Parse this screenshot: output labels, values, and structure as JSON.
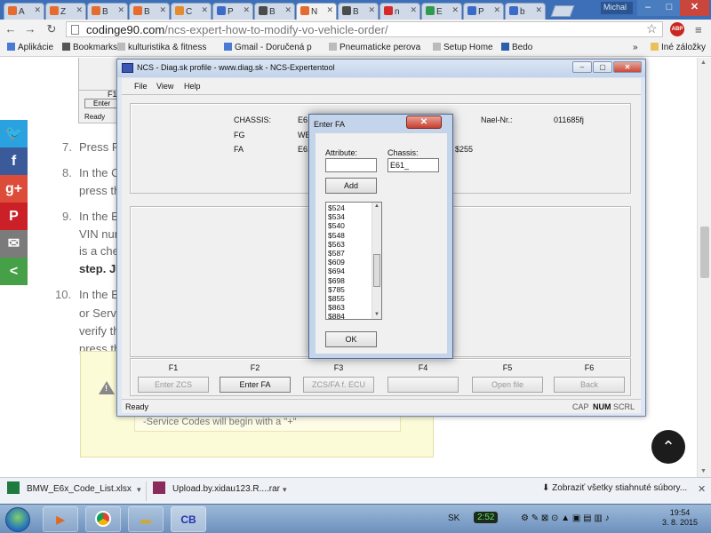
{
  "browser": {
    "tabs": [
      {
        "label": "A",
        "color": "#e56b2f"
      },
      {
        "label": "Z",
        "color": "#e56b2f"
      },
      {
        "label": "B",
        "color": "#e56b2f"
      },
      {
        "label": "B",
        "color": "#e56b2f"
      },
      {
        "label": "C",
        "color": "#e58a2f"
      },
      {
        "label": "P",
        "color": "#3b6bc9"
      },
      {
        "label": "B",
        "color": "#4b4b4b"
      },
      {
        "label": "N",
        "color": "#e56b2f"
      },
      {
        "label": "B",
        "color": "#4b4b4b"
      },
      {
        "label": "n",
        "color": "#d62a2a"
      },
      {
        "label": "E",
        "color": "#2e9b4f"
      },
      {
        "label": "P",
        "color": "#3b6bc9"
      },
      {
        "label": "b",
        "color": "#3b6bc9"
      }
    ],
    "active_tab_index": 7,
    "user": "Michal",
    "url_host": "codinge90.com",
    "url_path": "/ncs-expert-how-to-modify-vo-vehicle-order/",
    "bookmarks": [
      {
        "label": "Aplikácie",
        "icon": "apps-icon"
      },
      {
        "label": "Bookmarks",
        "icon": "star-icon"
      },
      {
        "label": "kulturistika & fitness",
        "icon": "page-icon"
      },
      {
        "label": "Gmail - Doručená p",
        "icon": "google-icon"
      },
      {
        "label": "Pneumaticke perova",
        "icon": "page-icon"
      },
      {
        "label": "Setup Home",
        "icon": "page-icon"
      },
      {
        "label": "Bedo",
        "icon": "z-icon"
      }
    ],
    "other_bookmarks": "Iné záložky",
    "bookmarks_overflow": "»",
    "abp_label": "ABP"
  },
  "article": {
    "items": [
      {
        "num": "7.",
        "text": "Press F"
      },
      {
        "num": "8.",
        "text": "In the C"
      },
      {
        "num": "",
        "text": "press th"
      },
      {
        "num": "9.",
        "text": "In the E"
      },
      {
        "num": "",
        "text": "VIN num"
      },
      {
        "num": "",
        "text": "is a che"
      },
      {
        "num": "",
        "text": "step. Ju",
        "bold": true
      },
      {
        "num": "10.",
        "text": "In the E"
      },
      {
        "num": "",
        "text": "or Servi"
      },
      {
        "num": "",
        "text": "verify th"
      },
      {
        "num": "",
        "text": "press th"
      }
    ],
    "warning_text": "-Service Codes will begin with a \"+\"",
    "partial_window_label": "F1",
    "partial_window_btn": "Enter",
    "partial_window_status": "Ready"
  },
  "social": [
    {
      "icon": "twitter-icon",
      "glyph": "🐦",
      "color": "#2aa2e0"
    },
    {
      "icon": "facebook-icon",
      "glyph": "f",
      "color": "#3b5a9a"
    },
    {
      "icon": "googleplus-icon",
      "glyph": "g+",
      "color": "#dd4b39"
    },
    {
      "icon": "pinterest-icon",
      "glyph": "P",
      "color": "#cb2027"
    },
    {
      "icon": "email-icon",
      "glyph": "✉",
      "color": "#7b7b7b"
    },
    {
      "icon": "share-icon",
      "glyph": "<",
      "color": "#46a047"
    }
  ],
  "ncs": {
    "title": "NCS - Diag.sk profile - www.diag.sk - NCS-Expertentool",
    "menu": [
      "File",
      "View",
      "Help"
    ],
    "chassis_label": "CHASSIS:",
    "chassis_value": "E6",
    "fg_label": "FG",
    "fg_value": "WB",
    "fa_label": "FA",
    "fa_value": "E61",
    "fa_tail": "$255",
    "nael_label": "Nael-Nr.:",
    "nael_value": "011685fj",
    "fkeys": [
      {
        "key": "F1",
        "label": "Enter ZCS",
        "enabled": false
      },
      {
        "key": "F2",
        "label": "Enter FA",
        "enabled": true
      },
      {
        "key": "F3",
        "label": "ZCS/FA f. ECU",
        "enabled": false
      },
      {
        "key": "F4",
        "label": "",
        "enabled": false
      },
      {
        "key": "F5",
        "label": "Open file",
        "enabled": false
      },
      {
        "key": "F6",
        "label": "Back",
        "enabled": false
      }
    ],
    "status": "Ready",
    "status_indicators": [
      "CAP",
      "NUM",
      "SCRL"
    ]
  },
  "dialog": {
    "title": "Enter FA",
    "attribute_label": "Attribute:",
    "attribute_value": "",
    "chassis_label": "Chassis:",
    "chassis_value": "E61_",
    "add_label": "Add",
    "ok_label": "OK",
    "list": [
      "$524",
      "$534",
      "$540",
      "$548",
      "$563",
      "$587",
      "$609",
      "$694",
      "$698",
      "$785",
      "$855",
      "$863",
      "$884"
    ]
  },
  "downloads": {
    "items": [
      {
        "name": "BMW_E6x_Code_List.xlsx",
        "icon": "excel-icon"
      },
      {
        "name": "Upload.by.xidau123.R....rar",
        "icon": "rar-icon"
      }
    ],
    "show_all": "Zobraziť všetky stiahnuté súbory..."
  },
  "taskbar": {
    "apps": [
      "media-player-icon",
      "chrome-icon",
      "explorer-icon",
      "ncs-icon"
    ],
    "lang": "SK",
    "time_badge": "2:52",
    "clock_time": "19:54",
    "clock_date": "3. 8. 2015"
  }
}
